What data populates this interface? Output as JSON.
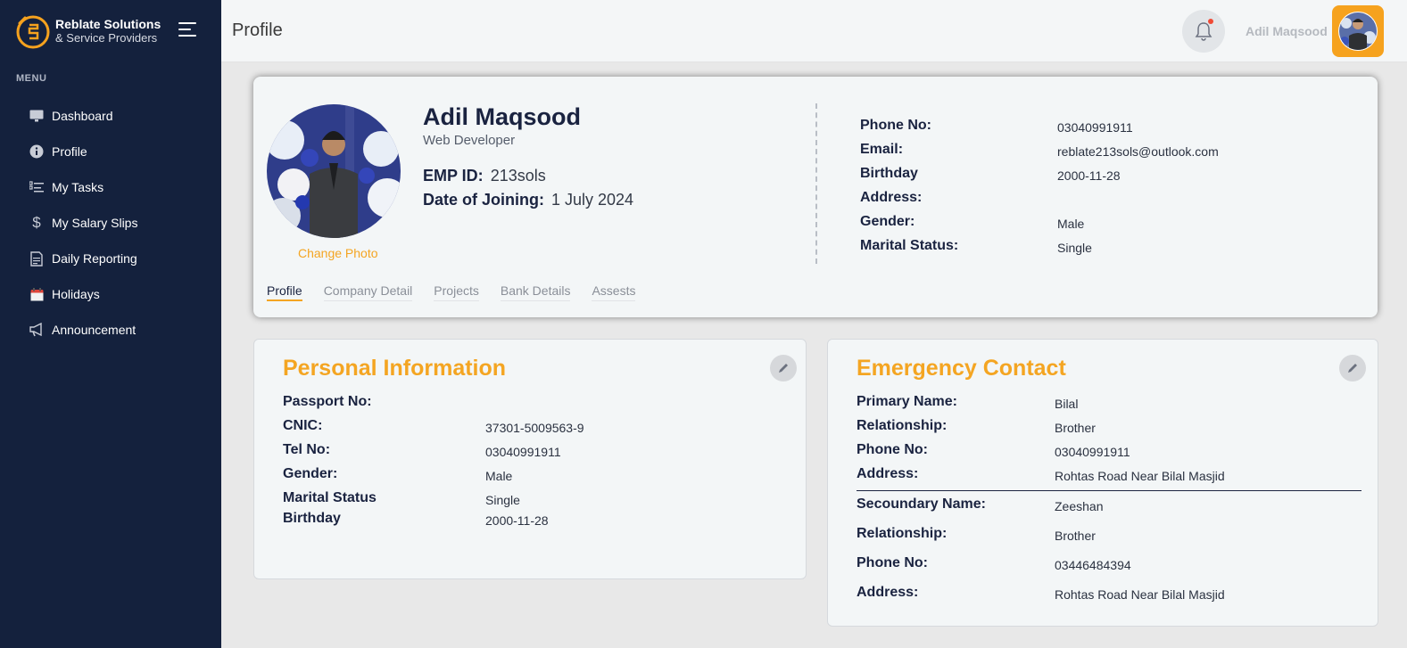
{
  "brand": {
    "name": "Reblate Solutions",
    "subtitle": "& Service Providers",
    "accent": "#f6a21e"
  },
  "sidebar": {
    "menu_heading": "MENU",
    "items": [
      {
        "label": "Dashboard",
        "icon": "dashboard-icon"
      },
      {
        "label": "Profile",
        "icon": "info-icon"
      },
      {
        "label": "My Tasks",
        "icon": "tasks-icon"
      },
      {
        "label": "My Salary Slips",
        "icon": "dollar-icon"
      },
      {
        "label": "Daily Reporting",
        "icon": "report-icon"
      },
      {
        "label": "Holidays",
        "icon": "calendar-icon"
      },
      {
        "label": "Announcement",
        "icon": "megaphone-icon"
      }
    ]
  },
  "header": {
    "title": "Profile",
    "user_name": "Adil Maqsood"
  },
  "profile": {
    "name": "Adil Maqsood",
    "role": "Web Developer",
    "change_photo": "Change Photo",
    "emp_id_label": "EMP ID:",
    "emp_id": "213sols",
    "doj_label": "Date of Joining:",
    "doj": "1 July 2024",
    "contact": [
      {
        "label": "Phone No:",
        "value": "03040991911"
      },
      {
        "label": "Email:",
        "value": "reblate213sols@outlook.com"
      },
      {
        "label": "Birthday",
        "value": "2000-11-28"
      },
      {
        "label": "Address:",
        "value": ""
      },
      {
        "label": "Gender:",
        "value": "Male"
      },
      {
        "label": "Marital Status:",
        "value": "Single"
      }
    ],
    "tabs": [
      "Profile",
      "Company Detail",
      "Projects",
      "Bank Details",
      "Assests"
    ]
  },
  "personal": {
    "title": "Personal Information",
    "rows": [
      {
        "label": "Passport No:",
        "value": ""
      },
      {
        "label": "CNIC:",
        "value": "37301-5009563-9"
      },
      {
        "label": "Tel No:",
        "value": "03040991911"
      },
      {
        "label": "Gender:",
        "value": "Male"
      },
      {
        "label": "Marital Status",
        "value": "Single"
      },
      {
        "label": "Birthday",
        "value": "2000-11-28"
      }
    ]
  },
  "emergency": {
    "title": "Emergency Contact",
    "primary": [
      {
        "label": "Primary Name:",
        "value": "Bilal"
      },
      {
        "label": "Relationship:",
        "value": "Brother"
      },
      {
        "label": "Phone No:",
        "value": "03040991911"
      },
      {
        "label": "Address:",
        "value": "Rohtas Road Near Bilal Masjid"
      }
    ],
    "secondary": [
      {
        "label": "Secoundary Name:",
        "value": "Zeeshan"
      },
      {
        "label": "Relationship:",
        "value": "Brother"
      },
      {
        "label": "Phone No:",
        "value": "03446484394"
      },
      {
        "label": "Address:",
        "value": "Rohtas Road Near Bilal Masjid"
      }
    ]
  }
}
